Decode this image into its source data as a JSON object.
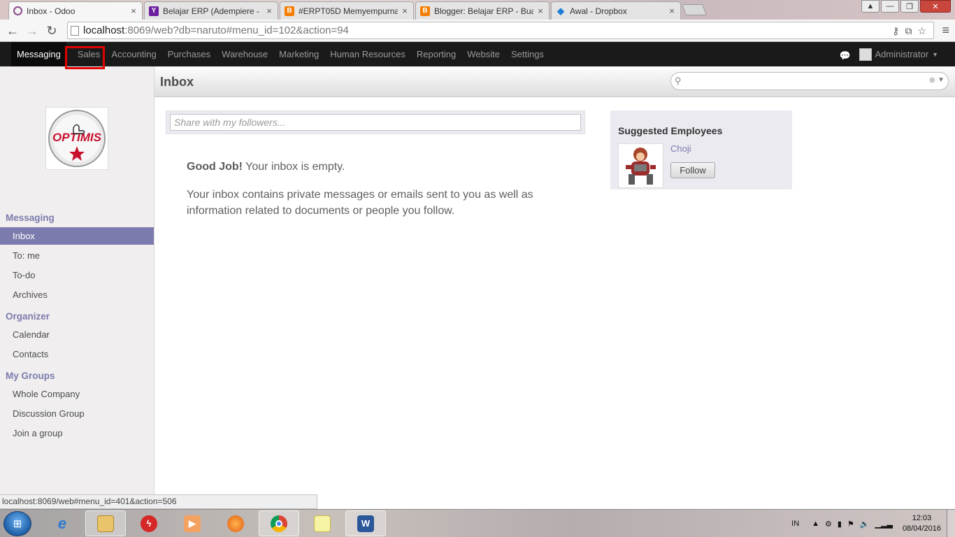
{
  "browser": {
    "tabs": [
      {
        "title": "Inbox - Odoo",
        "icon": "odoo-icon",
        "active": true
      },
      {
        "title": "Belajar ERP (Adempiere - ",
        "icon": "yahoo-icon",
        "active": false
      },
      {
        "title": "#ERPT05D Memyempurna",
        "icon": "blogger-icon",
        "active": false
      },
      {
        "title": "Blogger: Belajar ERP - Bua",
        "icon": "blogger-icon",
        "active": false
      },
      {
        "title": "Awal - Dropbox",
        "icon": "dropbox-icon",
        "active": false
      }
    ],
    "close_glyph": "×",
    "url_host": "localhost",
    "url_path": ":8069/web?db=naruto#menu_id=102&action=94",
    "status_url": "localhost:8069/web#menu_id=401&action=506"
  },
  "topbar": {
    "menus": [
      "Messaging",
      "Sales",
      "Accounting",
      "Purchases",
      "Warehouse",
      "Marketing",
      "Human Resources",
      "Reporting",
      "Website",
      "Settings"
    ],
    "active_menu": "Messaging",
    "highlighted_menu": "Sales",
    "user_name": "Administrator"
  },
  "sidebar": {
    "logo_text": "OPTIMIS",
    "sections": [
      {
        "title": "Messaging",
        "items": [
          "Inbox",
          "To: me",
          "To-do",
          "Archives"
        ]
      },
      {
        "title": "Organizer",
        "items": [
          "Calendar",
          "Contacts"
        ]
      },
      {
        "title": "My Groups",
        "items": [
          "Whole Company",
          "Discussion Group",
          "Join a group"
        ]
      }
    ],
    "active_item": "Inbox"
  },
  "main": {
    "title": "Inbox",
    "compose_placeholder": "Share with my followers...",
    "empty_strong": "Good Job!",
    "empty_rest": " Your inbox is empty.",
    "empty_detail": "Your inbox contains private messages or emails sent to you as well as information related to documents or people you follow."
  },
  "suggestions": {
    "title": "Suggested Employees",
    "employee_name": "Choji",
    "follow_label": "Follow"
  },
  "taskbar": {
    "lang": "IN",
    "time": "12:03",
    "date": "08/04/2016"
  },
  "colors": {
    "accent": "#7c7bad",
    "topbar": "#1a1a1a",
    "highlight": "#e10000"
  }
}
